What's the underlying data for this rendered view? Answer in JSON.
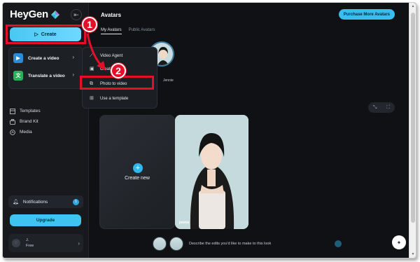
{
  "sidebar": {
    "brand": "HeyGen",
    "create_label": "Create",
    "nav": [
      {
        "label": "Templates",
        "icon": "templates-icon"
      },
      {
        "label": "Brand Kit",
        "icon": "brand-kit-icon"
      },
      {
        "label": "Media",
        "icon": "media-icon"
      }
    ],
    "notifications_label": "Notifications",
    "notifications_count": "1",
    "upgrade_label": "Upgrade",
    "account": {
      "initial": "J.",
      "plan": "Free"
    }
  },
  "create_menu": {
    "items": [
      {
        "label": "Create a video",
        "color": "#2a8cd6"
      },
      {
        "label": "Translate a video",
        "color": "#2bb05a"
      }
    ]
  },
  "submenu": {
    "items": [
      {
        "label": "Video Agent"
      },
      {
        "label": "Create"
      },
      {
        "label": "Photo to video"
      },
      {
        "label": "Use a template"
      }
    ]
  },
  "main": {
    "title": "Avatars",
    "purchase_label": "Purchase More Avatars",
    "tabs": [
      "My Avatars",
      "Public Avatars"
    ],
    "thumb_name": "Jennie",
    "create_card_label": "Create new",
    "photo_card_name": "jennie",
    "prompt_placeholder": "Describe the edits you'd like to make to this look"
  },
  "annotations": {
    "step1": "1",
    "step2": "2",
    "highlight_color": "#e3102a"
  }
}
